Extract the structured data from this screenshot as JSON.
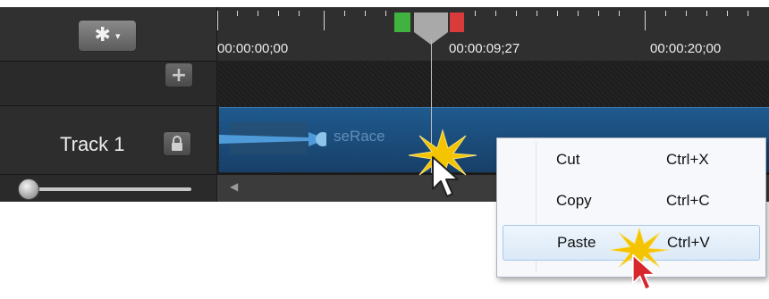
{
  "toolbar": {
    "settings_icon": "gear-icon",
    "settings_caret": "▾"
  },
  "track": {
    "name": "Track 1",
    "add_icon": "plus-icon",
    "lock_icon": "lock-icon"
  },
  "ruler": {
    "labels": [
      "00:00:00;00",
      "00:00:09;27",
      "00:00:20;00"
    ]
  },
  "clip": {
    "label": "seRace"
  },
  "scrollbar": {
    "left_arrow": "◀"
  },
  "context_menu": {
    "items": [
      {
        "label": "Cut",
        "shortcut": "Ctrl+X"
      },
      {
        "label": "Copy",
        "shortcut": "Ctrl+C"
      },
      {
        "label": "Paste",
        "shortcut": "Ctrl+V"
      }
    ],
    "highlighted": "Paste"
  },
  "colors": {
    "clip": "#1f5a8e",
    "marker_in": "#3fb23f",
    "marker_out": "#d93b3b",
    "click_burst": "#f5c400"
  }
}
